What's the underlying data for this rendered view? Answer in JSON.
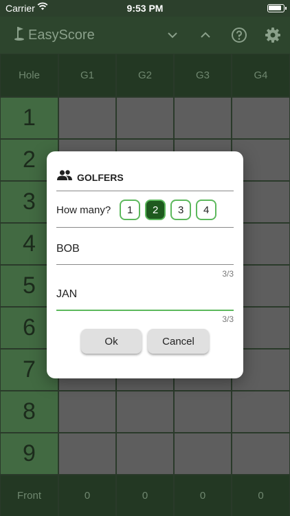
{
  "status_bar": {
    "carrier": "Carrier",
    "time": "9:53 PM"
  },
  "app_bar": {
    "app_name": "EasyScore",
    "icons": [
      "golf-flag-icon",
      "chevron-down-icon",
      "chevron-up-icon",
      "help-icon",
      "settings-gear-icon"
    ]
  },
  "scorecard": {
    "header": [
      "Hole",
      "G1",
      "G2",
      "G3",
      "G4"
    ],
    "holes": [
      "1",
      "2",
      "3",
      "4",
      "5",
      "6",
      "7",
      "8",
      "9"
    ],
    "footer": [
      "Front",
      "0",
      "0",
      "0",
      "0"
    ]
  },
  "dialog": {
    "title": "GOLFERS",
    "title_icon": "people-group-icon",
    "how_many_label": "How many?",
    "count_options": [
      "1",
      "2",
      "3",
      "4"
    ],
    "selected_count": "2",
    "golfers": [
      {
        "name": "BOB",
        "counter": "3/3"
      },
      {
        "name": "JAN",
        "counter": "3/3"
      }
    ],
    "ok_label": "Ok",
    "cancel_label": "Cancel"
  },
  "colors": {
    "accent_green": "#5cb85c",
    "selected_green": "#1e5a1e",
    "header_green": "#233823",
    "hole_green": "#426a42"
  }
}
